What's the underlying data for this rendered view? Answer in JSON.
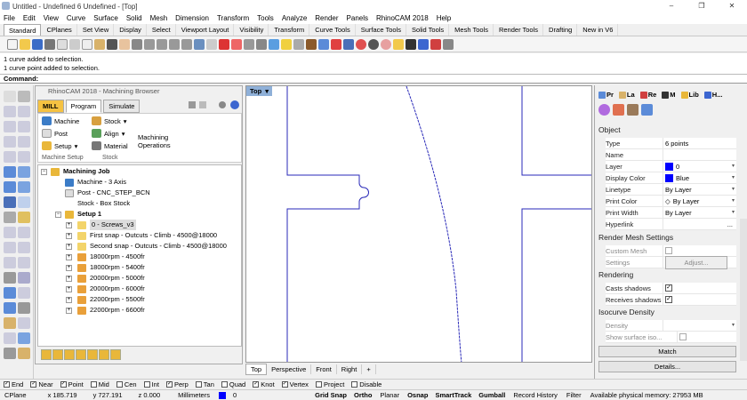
{
  "titlebar": {
    "title": "Untitled - Undefined 6 Undefined - [Top]",
    "min": "–",
    "max": "❐",
    "close": "✕"
  },
  "menu": [
    "File",
    "Edit",
    "View",
    "Curve",
    "Surface",
    "Solid",
    "Mesh",
    "Dimension",
    "Transform",
    "Tools",
    "Analyze",
    "Render",
    "Panels",
    "RhinoCAM 2018",
    "Help"
  ],
  "tabs": [
    "Standard",
    "CPlanes",
    "Set View",
    "Display",
    "Select",
    "Viewport Layout",
    "Visibility",
    "Transform",
    "Curve Tools",
    "Surface Tools",
    "Solid Tools",
    "Mesh Tools",
    "Render Tools",
    "Drafting",
    "New in V6"
  ],
  "command": {
    "history": [
      "1 curve added to selection.",
      "1 curve point added to selection."
    ],
    "prompt": "Command:"
  },
  "browser": {
    "title": "RhinoCAM 2018 - Machining Browser",
    "tabs": {
      "mill": "MILL",
      "program": "Program",
      "simulate": "Simulate"
    },
    "ribbon": {
      "machine": "Machine",
      "post": "Post",
      "setup": "Setup",
      "stock": "Stock",
      "align": "Align",
      "material": "Material",
      "ops": "Machining",
      "ops2": "Operations",
      "grp_setup": "Machine Setup",
      "grp_stock": "Stock"
    },
    "tree": {
      "job": "Machining Job",
      "machine": "Machine - 3 Axis",
      "post": "Post - CNC_STEP_BCN",
      "stock": "Stock - Box Stock",
      "setup": "Setup 1",
      "items": [
        "0 - Screws_v3",
        "First snap - Outcuts - Climb - 4500@18000",
        "Second snap - Outcuts - Climb - 4500@18000",
        "18000rpm - 4500fr",
        "18000rpm - 5400fr",
        "20000rpm - 5000fr",
        "20000rpm - 6000fr",
        "22000rpm - 5500fr",
        "22000rpm - 6600fr"
      ]
    }
  },
  "viewport": {
    "title": "Top",
    "tabs": [
      "Top",
      "Perspective",
      "Front",
      "Right"
    ],
    "add": "+"
  },
  "properties": {
    "tabs": [
      "Pr",
      "La",
      "Re",
      "M",
      "Lib",
      "H..."
    ],
    "object_header": "Object",
    "rows": [
      {
        "k": "Type",
        "v": "6 points"
      },
      {
        "k": "Name",
        "v": ""
      },
      {
        "k": "Layer",
        "v": "0"
      },
      {
        "k": "Display Color",
        "v": "Blue"
      },
      {
        "k": "Linetype",
        "v": "By Layer"
      },
      {
        "k": "Print Color",
        "v": "By Layer"
      },
      {
        "k": "Print Width",
        "v": "By Layer"
      },
      {
        "k": "Hyperlink",
        "v": "..."
      }
    ],
    "mesh_header": "Render Mesh Settings",
    "custom_mesh": "Custom Mesh",
    "settings": "Settings",
    "adjust": "Adjust...",
    "render_header": "Rendering",
    "casts": "Casts shadows",
    "receives": "Receives shadows",
    "iso_header": "Isocurve Density",
    "density": "Density",
    "show_iso": "Show surface iso...",
    "match": "Match",
    "details": "Details...",
    "colors": {
      "blue": "#0000ff"
    }
  },
  "osnap": [
    "End",
    "Near",
    "Point",
    "Mid",
    "Cen",
    "Int",
    "Perp",
    "Tan",
    "Quad",
    "Knot",
    "Vertex",
    "Project",
    "Disable"
  ],
  "status": {
    "cplane": "CPlane",
    "x": "x 185.719",
    "y": "y 727.191",
    "z": "z 0.000",
    "units": "Millimeters",
    "layer": "0",
    "toggles": [
      "Grid Snap",
      "Ortho",
      "Planar",
      "Osnap",
      "SmartTrack",
      "Gumball",
      "Record History",
      "Filter"
    ],
    "memory": "Available physical memory: 27953 MB"
  }
}
